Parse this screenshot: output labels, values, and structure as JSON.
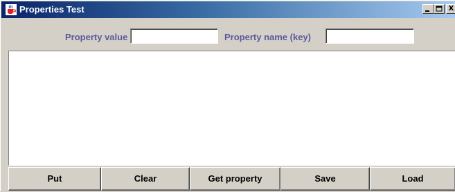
{
  "window": {
    "title": "Properties Test",
    "app_icon": "java-cup-icon",
    "controls": {
      "minimize_icon": "minimize-icon",
      "maximize_icon": "maximize-icon",
      "close_icon": "close-icon",
      "close_glyph": "X"
    }
  },
  "form": {
    "value_label": "Property value",
    "value_input": "",
    "key_label": "Property name (key)",
    "key_input": ""
  },
  "output": {
    "text": ""
  },
  "buttons": {
    "put": "Put",
    "clear": "Clear",
    "get_property": "Get property",
    "save": "Save",
    "load": "Load"
  },
  "colors": {
    "titlebar_start": "#0a246a",
    "titlebar_end": "#a6caf0",
    "label_text": "#5a5a9a",
    "window_bg": "#d4d0c8"
  }
}
